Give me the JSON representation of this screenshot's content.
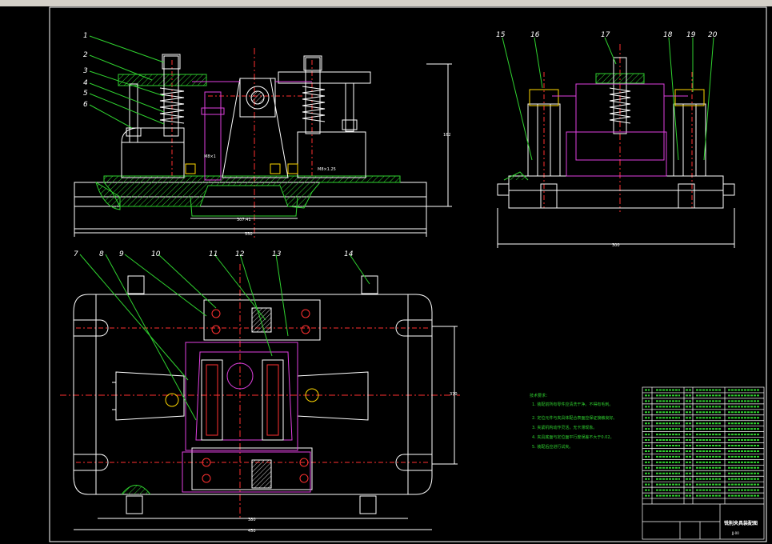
{
  "balloons": {
    "front": [
      "1",
      "2",
      "3",
      "4",
      "5",
      "6"
    ],
    "side": [
      "15",
      "16",
      "17",
      "18",
      "19",
      "20"
    ],
    "plan": [
      "7",
      "8",
      "9",
      "10",
      "11",
      "12",
      "13",
      "14"
    ]
  },
  "dims": {
    "front_width": "550",
    "front_inner": "307.41",
    "front_height": "162",
    "side_width": "300",
    "plan_width": "380",
    "plan_total": "450",
    "plan_height": "370"
  },
  "small_labels": {
    "front_a": "M8×1",
    "front_b": "M8×1.25"
  },
  "notes": {
    "title": "技术要求：",
    "items": [
      "1.  装配前所有零件应清洗干净。不得有毛刺。",
      "2.  定位元件与夹具体配合表面应保证接触良好。",
      "3.  夹紧机构动作灵活，无卡滞现象。",
      "4.  夹具底面与定位面平行度误差不大于0.02。",
      "5.  装配后应进行试夹。"
    ]
  },
  "title_block": {
    "drawing_name": "铣削夹具装配图",
    "code": "JJ-00"
  }
}
